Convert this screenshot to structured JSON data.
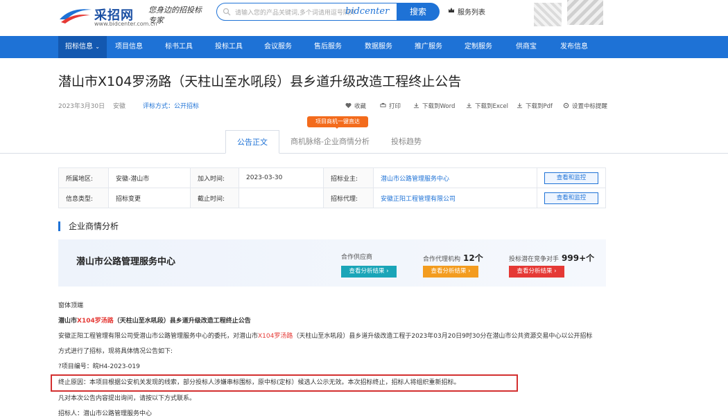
{
  "header": {
    "logo_name": "采招网",
    "logo_url": "www.bidcenter.com.cn",
    "slogan": "您身边的招投标专家",
    "search_placeholder": "请输入您的产品关键词,多个词请用逗号隔开",
    "search_brand": "bidcenter",
    "search_button": "搜索",
    "service_list": "服务列表"
  },
  "nav": {
    "items": [
      "招标信息",
      "项目信息",
      "标书工具",
      "投标工具",
      "会议服务",
      "售后服务",
      "数据服务",
      "推广服务",
      "定制服务",
      "供商宝",
      "发布信息"
    ]
  },
  "notice": {
    "title": "潜山市X104罗汤路（天柱山至水吼段）县乡道升级改造工程终止公告",
    "date": "2023年3月30日",
    "region": "安徽",
    "method": "评标方式：公开招标"
  },
  "tools": [
    "收藏",
    "打印",
    "下载到Word",
    "下载到Excel",
    "下载到Pdf",
    "设置中标提醒"
  ],
  "tabs": {
    "hot_badge": "项目商机一键直达",
    "items": [
      "公告正文",
      "商机脉络-企业商情分析",
      "投标趋势"
    ]
  },
  "info_table": {
    "region_label": "所属地区:",
    "region_value": "安徽-潜山市",
    "join_time_label": "加入时间:",
    "join_time_value": "2023-03-30",
    "owner_label": "招标业主:",
    "owner_value": "潜山市公路管理服务中心",
    "type_label": "信息类型:",
    "type_value": "招标变更",
    "deadline_label": "截止时间:",
    "deadline_value": "",
    "agent_label": "招标代理:",
    "agent_value": "安徽正阳工程管理有限公司",
    "watch_button": "查看和监控"
  },
  "analysis": {
    "section_title": "企业商情分析",
    "company": "潜山市公路管理服务中心",
    "supplier_label": "合作供应商",
    "agency_label": "合作代理机构",
    "agency_count": "12个",
    "rivals_label": "投标潜在竞争对手",
    "rivals_count": "999+个",
    "view_result": "查看分析结果 ›"
  },
  "content": {
    "line1": "窗体顶端",
    "line2_a": "潜山市",
    "line2_b": "X104罗汤路",
    "line2_c": "（天柱山至水吼段）县乡道升级改造工程终止公告",
    "line3_a": "安徽正阳工程管理有限公司受潜山市公路管理服务中心的委托，对潜山市",
    "line3_b": "X104罗汤路",
    "line3_c": "（天柱山至水吼段）县乡道升级改造工程于2023年03月20日9时30分在潜山市公共资源交易中心以公开招标",
    "line4": "方式进行了招标，现将具体情况公告如下:",
    "line5": "?项目编号：皖H4-2023-019",
    "line6": "终止原因：本项目根据公安机关发现的线索，部分投标人涉嫌串标围标，原中标(定标）候选人公示无效。本次招标终止，招标人将组织重新招标。",
    "line7": "凡对本次公告内容提出询问，请按以下方式联系。",
    "line8": "招标人：潜山市公路管理服务中心"
  },
  "colors": {
    "brand": "#1e72d6",
    "nav": "#1e72d6",
    "highlight": "#d32f2f",
    "cyan": "#1aa5b8",
    "orange": "#f39c1f",
    "red": "#e53935"
  }
}
